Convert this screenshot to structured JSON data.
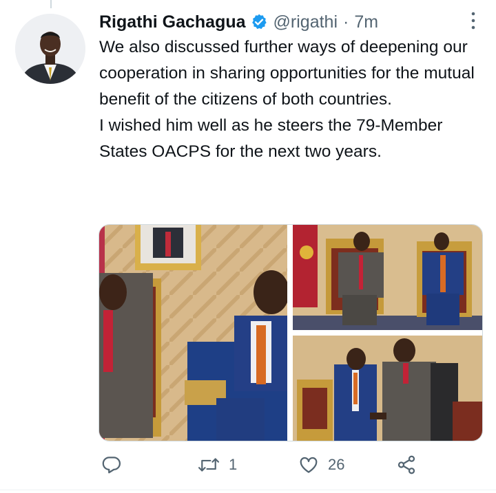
{
  "tweet": {
    "author_name": "Rigathi Gachagua",
    "handle": "@rigathi",
    "separator": "·",
    "time": "7m",
    "verified": true,
    "text_lines": [
      "We also discussed further ways of deepening our cooperation in sharing opportunities for the mutual benefit of the citizens of both countries.",
      "I wished him well as he steers the 79-Member States OACPS for the next two years."
    ],
    "media_count": 3
  },
  "actions": {
    "reply_count": "",
    "retweet_count": "1",
    "like_count": "26"
  },
  "icons": {
    "reply": "reply-icon",
    "retweet": "retweet-icon",
    "like": "heart-icon",
    "share": "share-icon",
    "more": "more-icon",
    "verified": "verified-badge-icon"
  },
  "colors": {
    "text": "#0f1419",
    "secondary": "#536471",
    "verified_blue": "#1d9bf0"
  }
}
